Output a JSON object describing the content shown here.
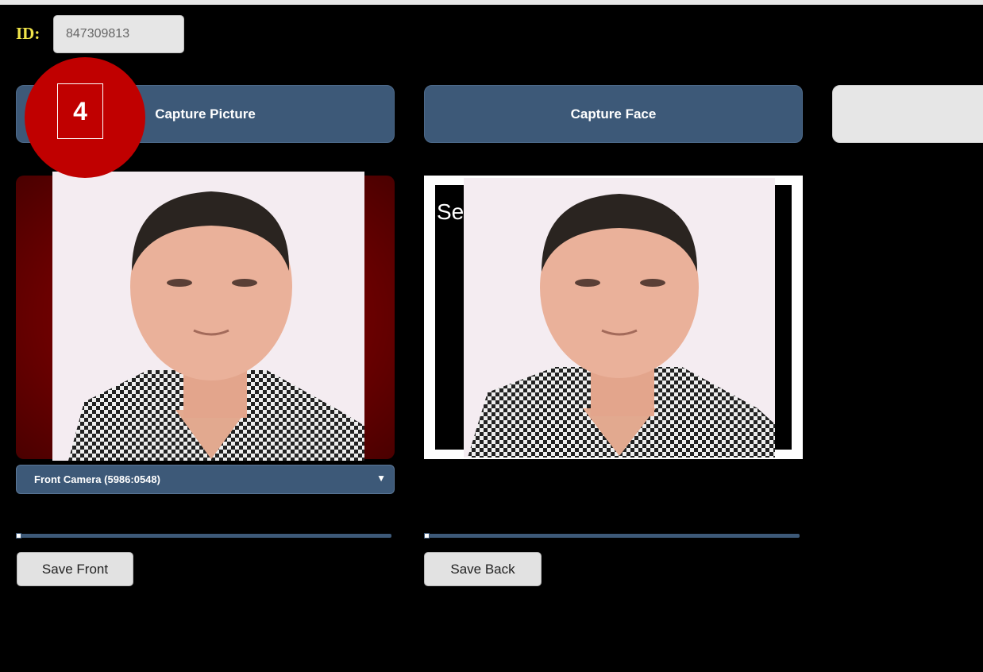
{
  "id_field": {
    "label": "ID:",
    "value": "847309813"
  },
  "buttons": {
    "capture_picture": "Capture Picture",
    "capture_face": "Capture Face",
    "third": ""
  },
  "step_badge": {
    "number": "4"
  },
  "face_panel": {
    "caption": "Se                                        e"
  },
  "camera_select": {
    "selected": "Front Camera (5986:0548)",
    "arrow": "▼"
  },
  "sliders": {
    "front_value": 0,
    "back_value": 0
  },
  "save": {
    "front_label": "Save Front",
    "back_label": "Save Back"
  },
  "colors": {
    "accent": "#3d5978",
    "badge": "#c00000",
    "id_label": "#f0e44a"
  }
}
